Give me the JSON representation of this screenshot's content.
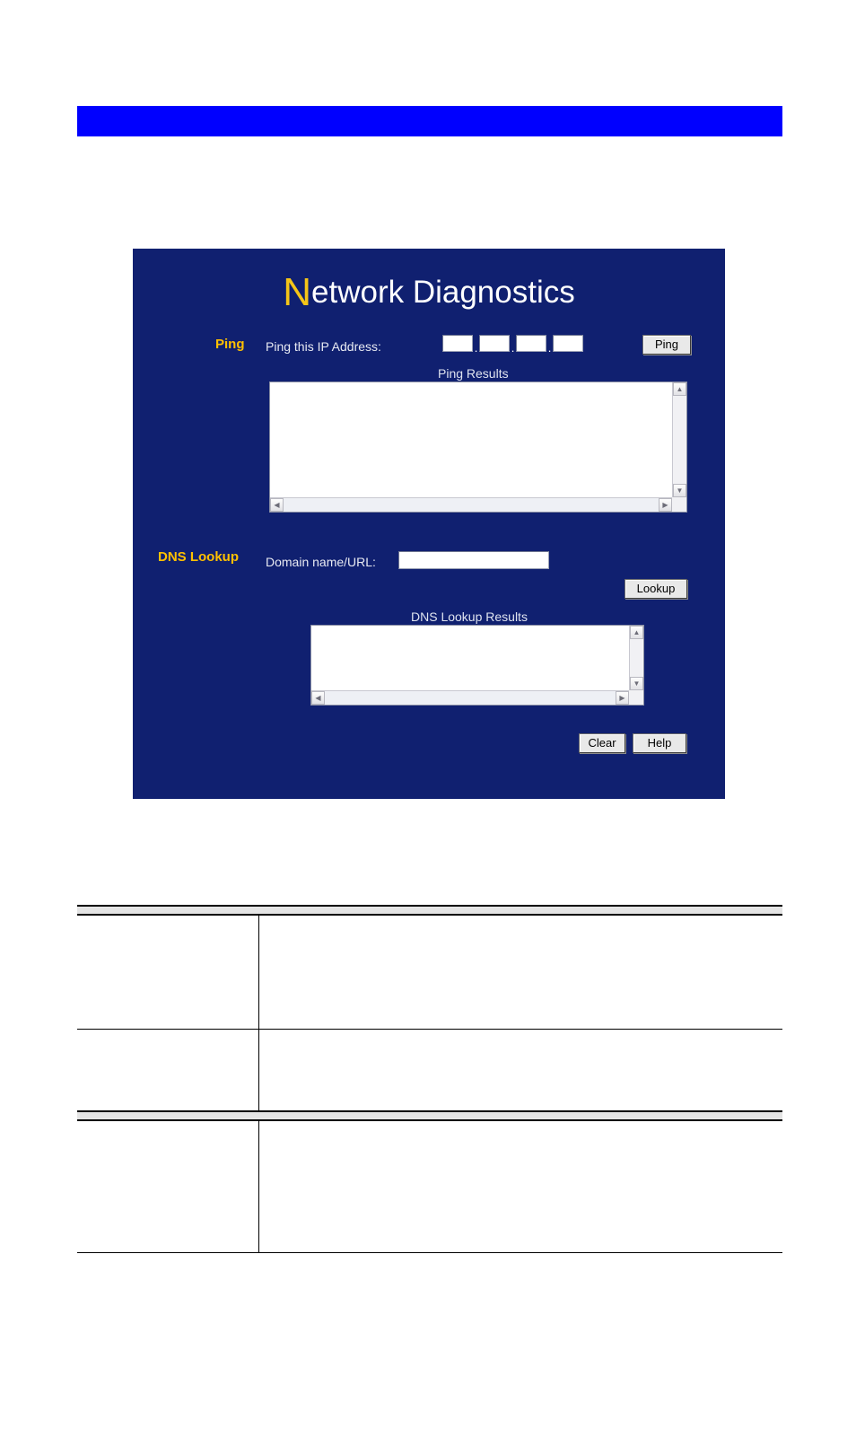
{
  "banner": {
    "text": ""
  },
  "panel": {
    "title_initial": "N",
    "title_rest": "etwork Diagnostics",
    "bg_color": "#102070",
    "accent_color": "#ffc000",
    "ping": {
      "section_label": "Ping",
      "field_label": "Ping this IP Address:",
      "octets": [
        "",
        "",
        "",
        ""
      ],
      "octet_separator": ".",
      "button_label": "Ping",
      "results_caption": "Ping Results",
      "results_value": ""
    },
    "dns": {
      "section_label": "DNS Lookup",
      "field_label": "Domain name/URL:",
      "domain_value": "",
      "button_label": "Lookup",
      "results_caption": "DNS Lookup Results",
      "results_value": ""
    },
    "footer": {
      "clear_label": "Clear",
      "help_label": "Help"
    },
    "scroll_icons": {
      "up": "▲",
      "down": "▼",
      "left": "◀",
      "right": "▶"
    }
  },
  "desc_table": {
    "sections": [
      {
        "heading": "",
        "rows": [
          {
            "name": "",
            "desc": ""
          },
          {
            "name": "",
            "desc": ""
          }
        ]
      },
      {
        "heading": "",
        "rows": [
          {
            "name": "",
            "desc": ""
          }
        ]
      }
    ]
  }
}
